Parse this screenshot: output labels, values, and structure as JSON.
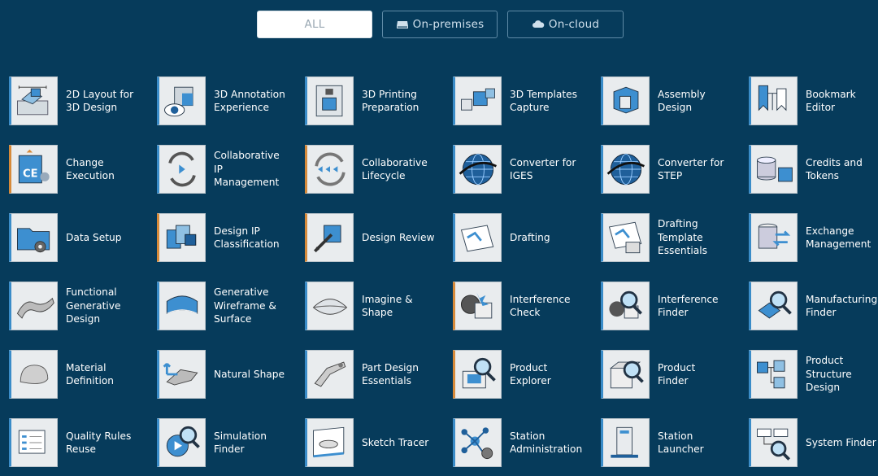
{
  "filters": [
    {
      "label": "ALL",
      "icon": "",
      "active": true
    },
    {
      "label": "On-premises",
      "icon": "server-icon",
      "active": false
    },
    {
      "label": "On-cloud",
      "icon": "cloud-icon",
      "active": false
    }
  ],
  "apps": [
    {
      "label": "2D Layout for\n3D Design",
      "icon": "layout-2d-icon",
      "accent": "blue"
    },
    {
      "label": "3D Annotation\nExperience",
      "icon": "annotation-3d-icon",
      "accent": "blue"
    },
    {
      "label": "3D Printing\nPreparation",
      "icon": "printer-3d-icon",
      "accent": "blue"
    },
    {
      "label": "3D Templates\nCapture",
      "icon": "templates-3d-icon",
      "accent": "blue"
    },
    {
      "label": "Assembly\nDesign",
      "icon": "assembly-icon",
      "accent": "blue"
    },
    {
      "label": "Bookmark\nEditor",
      "icon": "bookmark-icon",
      "accent": "blue"
    },
    {
      "label": "Change\nExecution",
      "icon": "change-execution-icon",
      "accent": "orange"
    },
    {
      "label": "Collaborative\nIP\nManagement",
      "icon": "collab-ip-icon",
      "accent": "blue"
    },
    {
      "label": "Collaborative\nLifecycle",
      "icon": "collab-lifecycle-icon",
      "accent": "orange"
    },
    {
      "label": "Converter for\nIGES",
      "icon": "globe-icon",
      "accent": "blue"
    },
    {
      "label": "Converter for\nSTEP",
      "icon": "globe-icon",
      "accent": "blue"
    },
    {
      "label": "Credits and\nTokens",
      "icon": "coins-icon",
      "accent": "blue"
    },
    {
      "label": "Data Setup",
      "icon": "folder-gear-icon",
      "accent": "blue"
    },
    {
      "label": "Design IP\nClassification",
      "icon": "classification-icon",
      "accent": "orange"
    },
    {
      "label": "Design Review",
      "icon": "design-review-icon",
      "accent": "orange"
    },
    {
      "label": "Drafting",
      "icon": "drafting-icon",
      "accent": "blue"
    },
    {
      "label": "Drafting\nTemplate\nEssentials",
      "icon": "drafting-template-icon",
      "accent": "blue"
    },
    {
      "label": "Exchange\nManagement",
      "icon": "database-exchange-icon",
      "accent": "blue"
    },
    {
      "label": "Functional\nGenerative\nDesign",
      "icon": "generative-part-icon",
      "accent": "blue"
    },
    {
      "label": "Generative\nWireframe &\nSurface",
      "icon": "wireframe-surface-icon",
      "accent": "blue"
    },
    {
      "label": "Imagine &\nShape",
      "icon": "shape-icon",
      "accent": "blue"
    },
    {
      "label": "Interference\nCheck",
      "icon": "interference-check-icon",
      "accent": "orange"
    },
    {
      "label": "Interference\nFinder",
      "icon": "interference-finder-icon",
      "accent": "blue"
    },
    {
      "label": "Manufacturing\nFinder",
      "icon": "manufacturing-finder-icon",
      "accent": "blue"
    },
    {
      "label": "Material\nDefinition",
      "icon": "material-icon",
      "accent": "blue"
    },
    {
      "label": "Natural Shape",
      "icon": "natural-shape-icon",
      "accent": "blue"
    },
    {
      "label": "Part Design\nEssentials",
      "icon": "part-design-icon",
      "accent": "blue"
    },
    {
      "label": "Product\nExplorer",
      "icon": "product-explorer-icon",
      "accent": "orange"
    },
    {
      "label": "Product\nFinder",
      "icon": "product-finder-icon",
      "accent": "blue"
    },
    {
      "label": "Product\nStructure\nDesign",
      "icon": "product-structure-icon",
      "accent": "blue"
    },
    {
      "label": "Quality Rules\nReuse",
      "icon": "checklist-icon",
      "accent": "blue"
    },
    {
      "label": "Simulation\nFinder",
      "icon": "simulation-finder-icon",
      "accent": "blue"
    },
    {
      "label": "Sketch Tracer",
      "icon": "sketch-tracer-icon",
      "accent": "blue"
    },
    {
      "label": "Station\nAdministration",
      "icon": "network-gear-icon",
      "accent": "blue"
    },
    {
      "label": "Station\nLauncher",
      "icon": "station-launcher-icon",
      "accent": "blue"
    },
    {
      "label": "System Finder",
      "icon": "system-finder-icon",
      "accent": "blue"
    }
  ],
  "colors": {
    "background": "#063b5b",
    "accent_blue": "#3a8cc8",
    "accent_orange": "#d68a3a"
  }
}
